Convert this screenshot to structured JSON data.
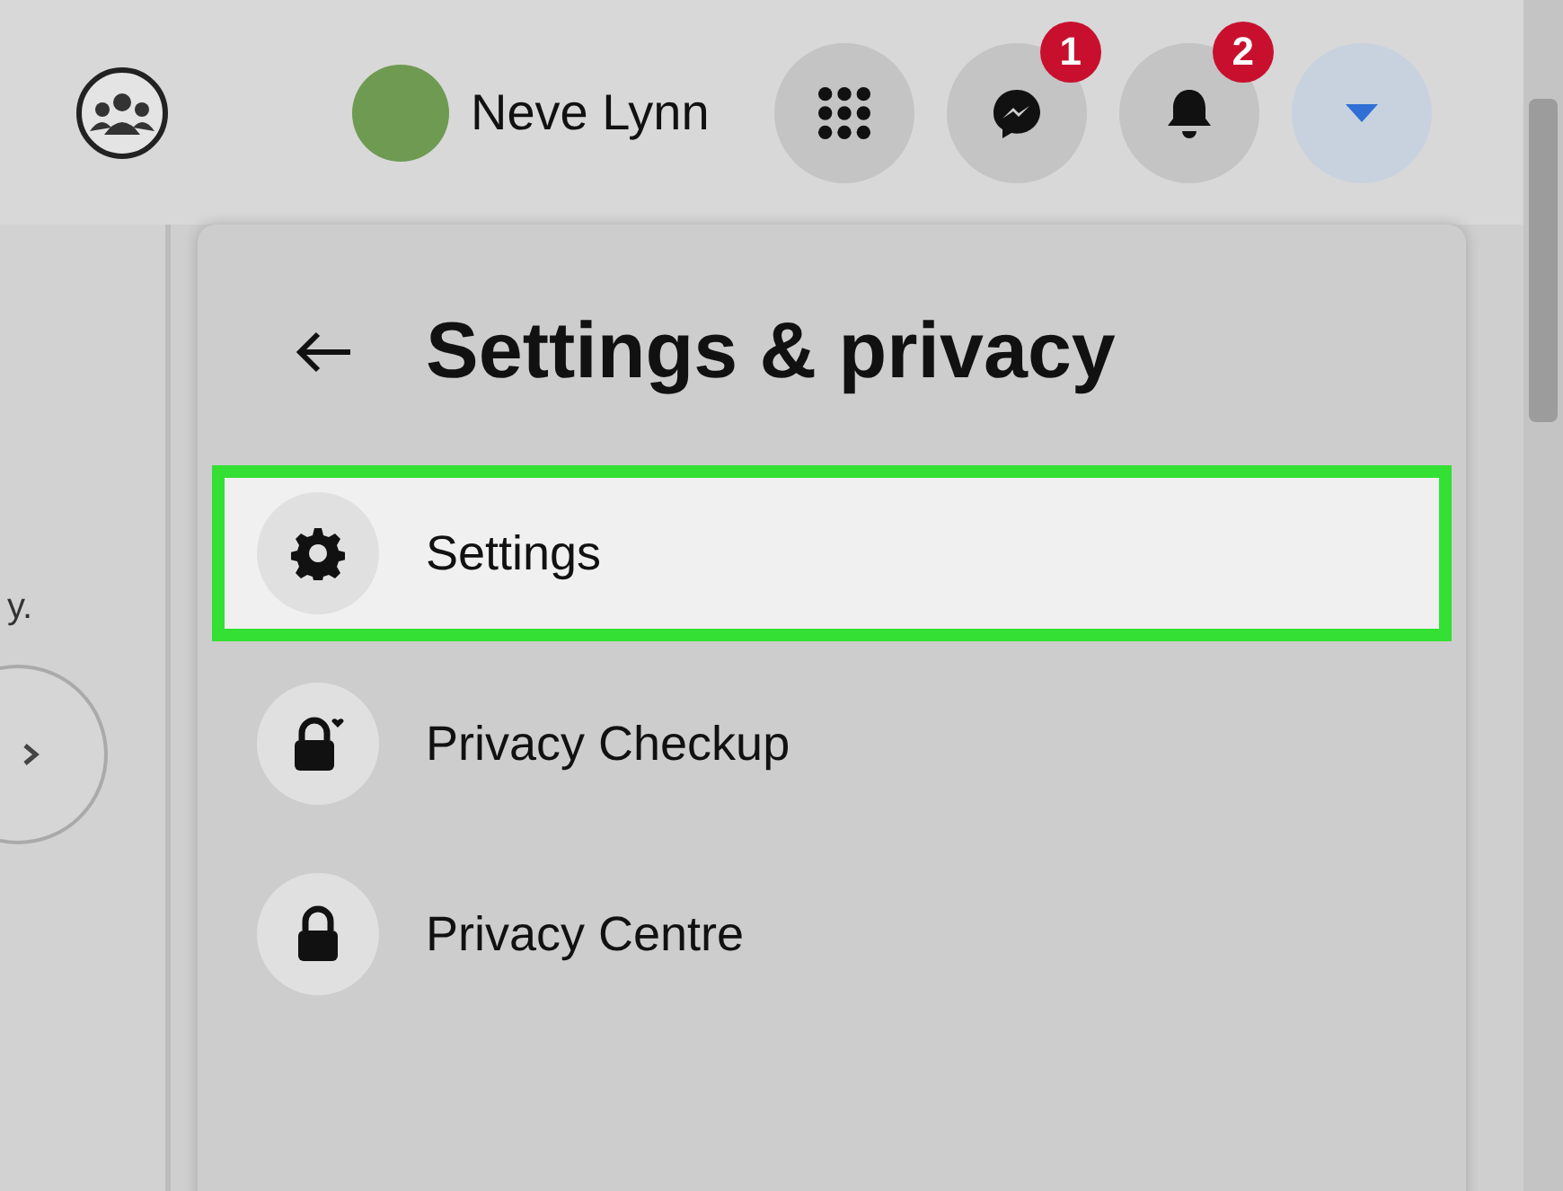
{
  "top_bar": {
    "profile": {
      "name": "Neve Lynn"
    },
    "buttons": [
      {
        "kind": "menu",
        "selected": false
      },
      {
        "kind": "messenger",
        "badge": "1",
        "selected": false
      },
      {
        "kind": "notifications",
        "badge": "2",
        "selected": false
      },
      {
        "kind": "account",
        "selected": true
      }
    ]
  },
  "left_fragment": {
    "text": "y."
  },
  "menu": {
    "title": "Settings & privacy",
    "items": [
      {
        "kind": "gear",
        "label": "Settings",
        "selected": true
      },
      {
        "kind": "lock-heart",
        "label": "Privacy Checkup",
        "selected": false
      },
      {
        "kind": "lock",
        "label": "Privacy Centre",
        "selected": false
      }
    ]
  }
}
